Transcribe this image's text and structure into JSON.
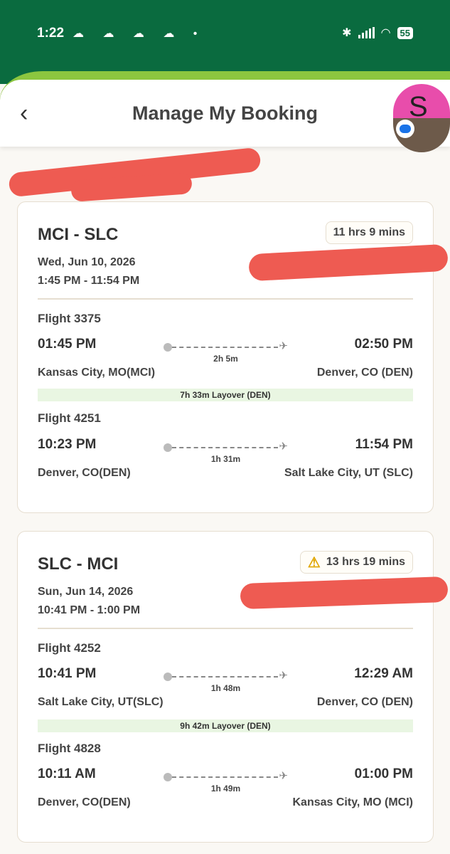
{
  "status_bar": {
    "time": "1:22",
    "notification_icons": "☁ ☁ ☁ ☁ •",
    "bluetooth_icon": "✱",
    "wifi_icon": "◠",
    "battery": "55"
  },
  "header": {
    "title": "Manage My Booking",
    "back_icon": "‹",
    "avatar_letter": "S"
  },
  "bookings": [
    {
      "route": "MCI - SLC",
      "total_duration": "11 hrs 9 mins",
      "date": "Wed, Jun 10, 2026",
      "time_range": "1:45 PM - 11:54 PM",
      "legs": [
        {
          "flight": "Flight 3375",
          "dep_time": "01:45 PM",
          "arr_time": "02:50 PM",
          "duration": "2h 5m",
          "dep_city": "Kansas City, MO(MCI)",
          "arr_city": "Denver, CO (DEN)"
        },
        {
          "flight": "Flight 4251",
          "dep_time": "10:23 PM",
          "arr_time": "11:54 PM",
          "duration": "1h 31m",
          "dep_city": "Denver, CO(DEN)",
          "arr_city": "Salt Lake City, UT (SLC)"
        }
      ],
      "layover": "7h 33m Layover (DEN)"
    },
    {
      "route": "SLC - MCI",
      "total_duration": "13 hrs 19 mins",
      "warning_icon": "⚠",
      "date": "Sun, Jun 14, 2026",
      "time_range": "10:41 PM - 1:00 PM",
      "legs": [
        {
          "flight": "Flight 4252",
          "dep_time": "10:41 PM",
          "arr_time": "12:29 AM",
          "duration": "1h 48m",
          "dep_city": "Salt Lake City, UT(SLC)",
          "arr_city": "Denver, CO (DEN)"
        },
        {
          "flight": "Flight 4828",
          "dep_time": "10:11 AM",
          "arr_time": "01:00 PM",
          "duration": "1h 49m",
          "dep_city": "Denver, CO(DEN)",
          "arr_city": "Kansas City, MO (MCI)"
        }
      ],
      "layover": "9h 42m Layover (DEN)"
    }
  ],
  "colors": {
    "brand_green": "#0a6b3f",
    "accent_lime": "#8cc63f",
    "redaction": "#ee5b52",
    "layover_bg": "#e9f6e2"
  }
}
